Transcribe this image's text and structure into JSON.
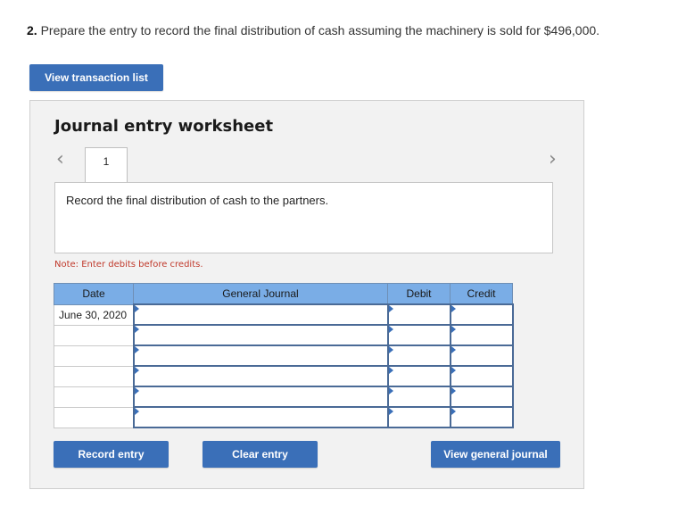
{
  "question": {
    "number": "2.",
    "text": "Prepare the entry to record the final distribution of cash assuming the machinery is sold for $496,000."
  },
  "buttons": {
    "view_transaction_list": "View transaction list",
    "record_entry": "Record entry",
    "clear_entry": "Clear entry",
    "view_general_journal": "View general journal"
  },
  "worksheet": {
    "title": "Journal entry worksheet",
    "prev_arrow": "‹",
    "next_arrow": "›",
    "tab_number": "1",
    "instruction": "Record the final distribution of cash to the partners.",
    "note": "Note: Enter debits before credits."
  },
  "journal": {
    "headers": {
      "date": "Date",
      "account": "General Journal",
      "debit": "Debit",
      "credit": "Credit"
    },
    "rows": [
      {
        "date": "June 30, 2020",
        "account": "",
        "debit": "",
        "credit": ""
      },
      {
        "date": "",
        "account": "",
        "debit": "",
        "credit": ""
      },
      {
        "date": "",
        "account": "",
        "debit": "",
        "credit": ""
      },
      {
        "date": "",
        "account": "",
        "debit": "",
        "credit": ""
      },
      {
        "date": "",
        "account": "",
        "debit": "",
        "credit": ""
      },
      {
        "date": "",
        "account": "",
        "debit": "",
        "credit": ""
      }
    ]
  },
  "colors": {
    "button": "#3a6fb8",
    "table_header": "#7aade6",
    "note": "#c0392b",
    "panel": "#f2f2f2"
  }
}
